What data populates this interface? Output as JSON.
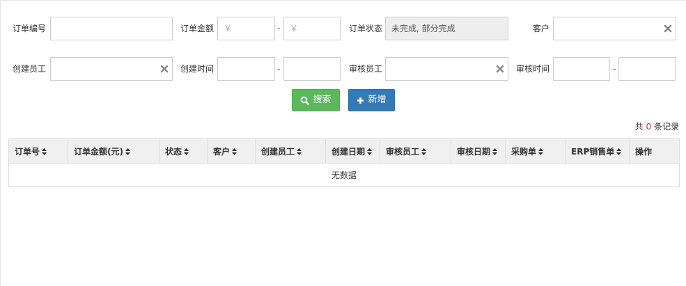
{
  "filters": {
    "order_no_label": "订单编号",
    "order_no_value": "",
    "amount_label": "订单金额",
    "amount_min_placeholder": "￥",
    "amount_max_placeholder": "￥",
    "amount_dash": "-",
    "status_label": "订单状态",
    "status_value": "未完成, 部分完成",
    "customer_label": "客户",
    "customer_value": "",
    "creator_label": "创建员工",
    "creator_value": "",
    "create_time_label": "创建时间",
    "create_time_dash": "-",
    "reviewer_label": "审核员工",
    "reviewer_value": "",
    "review_time_label": "审核时间",
    "review_time_dash": "-"
  },
  "buttons": {
    "search_label": "搜索",
    "add_label": "新增"
  },
  "summary": {
    "prefix": "共",
    "count": "0",
    "suffix": "条记录"
  },
  "table": {
    "columns": [
      "订单号",
      "订单金额(元)",
      "状态",
      "客户",
      "创建员工",
      "创建日期",
      "审核员工",
      "审核日期",
      "采购单",
      "ERP销售单",
      "操作"
    ],
    "empty_text": "无数据"
  },
  "colors": {
    "search_button": "#5cb85c",
    "add_button": "#337ab7",
    "count_highlight": "#c9302c",
    "header_bg": "#f0f0f0"
  },
  "icons": {
    "search": "search-icon",
    "add": "plus-icon",
    "clear": "clear-x-icon",
    "sort": "sort-icon"
  }
}
